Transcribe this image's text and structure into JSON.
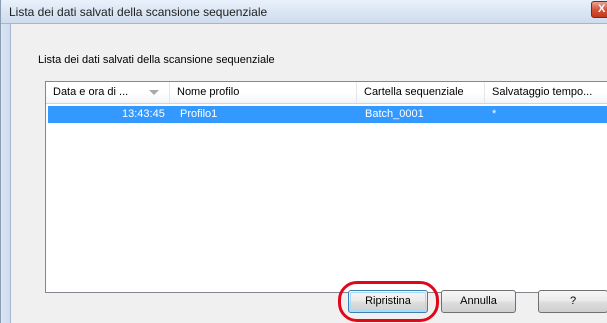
{
  "dialog": {
    "title": "Lista dei dati salvati della scansione sequenziale",
    "close_label": "X",
    "section_label": "Lista dei dati salvati della scansione sequenziale"
  },
  "list": {
    "columns": [
      "Data e ora di ...",
      "Nome profilo",
      "Cartella sequenziale",
      "Salvataggio tempo..."
    ],
    "rows": [
      {
        "datetime": "13:43:45",
        "profile": "Profilo1",
        "folder": "Batch_0001",
        "temp_save": "*"
      }
    ]
  },
  "buttons": {
    "restore": "Ripristina",
    "cancel": "Annulla",
    "help": "?"
  },
  "colors": {
    "selection": "#3399ff",
    "highlight": "#e2061a"
  }
}
